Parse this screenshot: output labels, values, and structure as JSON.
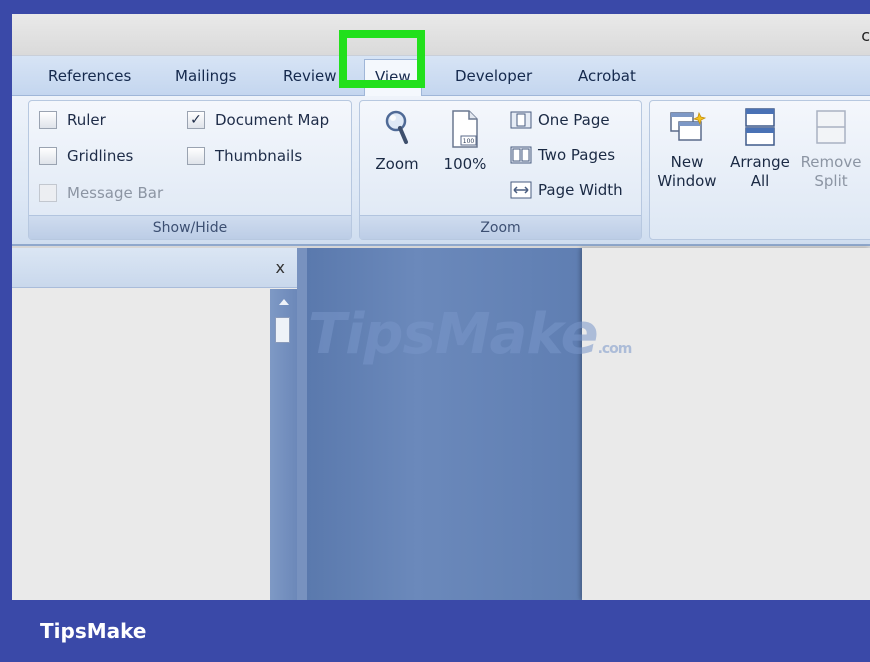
{
  "window": {
    "title_fragment": "c"
  },
  "tabs": [
    {
      "label": "References",
      "active": false
    },
    {
      "label": "Mailings",
      "active": false
    },
    {
      "label": "Review",
      "active": false
    },
    {
      "label": "View",
      "active": true
    },
    {
      "label": "Developer",
      "active": false
    },
    {
      "label": "Acrobat",
      "active": false
    }
  ],
  "show_hide": {
    "group_label": "Show/Hide",
    "items": [
      {
        "label": "Ruler",
        "checked": false,
        "enabled": true
      },
      {
        "label": "Gridlines",
        "checked": false,
        "enabled": true
      },
      {
        "label": "Message Bar",
        "checked": false,
        "enabled": false
      },
      {
        "label": "Document Map",
        "checked": true,
        "enabled": true,
        "check_glyph": "✓"
      },
      {
        "label": "Thumbnails",
        "checked": false,
        "enabled": true
      }
    ]
  },
  "zoom_group": {
    "group_label": "Zoom",
    "zoom_label": "Zoom",
    "hundred_label": "100%",
    "hundred_icon_text": "100",
    "one_page_label": "One Page",
    "two_pages_label": "Two Pages",
    "page_width_label": "Page Width"
  },
  "window_group": {
    "new_window_line1": "New",
    "new_window_line2": "Window",
    "arrange_all_line1": "Arrange",
    "arrange_all_line2": "All",
    "remove_split_line1": "Remove",
    "remove_split_line2": "Split"
  },
  "nav_pane": {
    "close_glyph": "x"
  },
  "watermark": {
    "text": "TipsMake",
    "suffix": ".com"
  },
  "footer": {
    "brand": "TipsMake"
  },
  "colors": {
    "highlight": "#22e01c",
    "frame": "#3a49a8",
    "document_background": "#5f7eb2"
  },
  "icons": [
    "search-icon",
    "page-100-icon",
    "one-page-icon",
    "two-pages-icon",
    "page-width-icon",
    "new-window-icon",
    "arrange-all-icon",
    "remove-split-icon",
    "close-icon"
  ]
}
